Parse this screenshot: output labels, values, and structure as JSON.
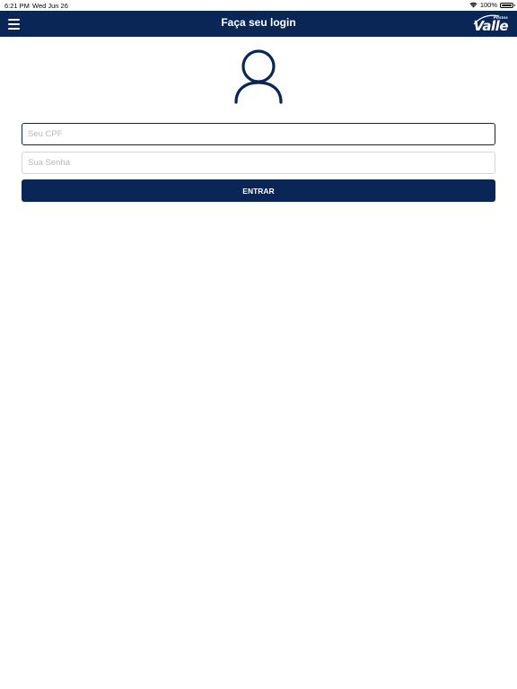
{
  "status_bar": {
    "time": "6:21 PM",
    "date": "Wed Jun 26",
    "battery_percent": "100%",
    "battery_level": 1.0,
    "icons": [
      "wifi-icon",
      "battery-icon"
    ]
  },
  "navbar": {
    "title": "Faça seu login",
    "menu_icon": "hamburger-menu-icon",
    "logo": {
      "small_text": "Postos",
      "main_text": "Valle"
    },
    "background_color": "#0a2657"
  },
  "avatar_icon": "user-icon",
  "form": {
    "cpf": {
      "placeholder": "Seu CPF",
      "value": ""
    },
    "password": {
      "placeholder": "Sua Senha",
      "value": ""
    },
    "submit_label": "ENTRAR"
  },
  "colors": {
    "primary": "#0a2657",
    "input_border": "#d4d8de",
    "placeholder": "#b4b8bd",
    "background": "#ffffff"
  }
}
